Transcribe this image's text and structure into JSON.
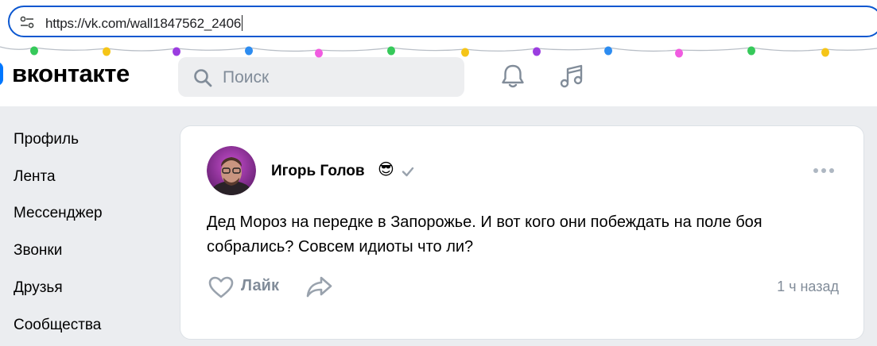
{
  "browser": {
    "url": "https://vk.com/wall1847562_2406",
    "icons": {
      "site_info": "tune-icon"
    }
  },
  "header": {
    "logo_text": "вконтакте",
    "search_placeholder": "Поиск",
    "icons": [
      "search-icon",
      "bell-icon",
      "music-note-icon"
    ]
  },
  "sidebar": {
    "items": [
      {
        "label": "Профиль"
      },
      {
        "label": "Лента"
      },
      {
        "label": "Мессенджер"
      },
      {
        "label": "Звонки"
      },
      {
        "label": "Друзья"
      },
      {
        "label": "Сообщества"
      }
    ]
  },
  "post": {
    "author": "Игорь Голов",
    "author_emoji": "😎",
    "text": "Дед Мороз на передке в Запорожье. И вот кого они побеждать на поле боя собрались? Совсем идиоты что ли?",
    "like_label": "Лайк",
    "time": "1 ч назад"
  },
  "colors": {
    "accent": "#0077ff",
    "page_bg": "#ebedf0",
    "secondary_text": "#818c99",
    "url_border": "#0b57d0"
  }
}
